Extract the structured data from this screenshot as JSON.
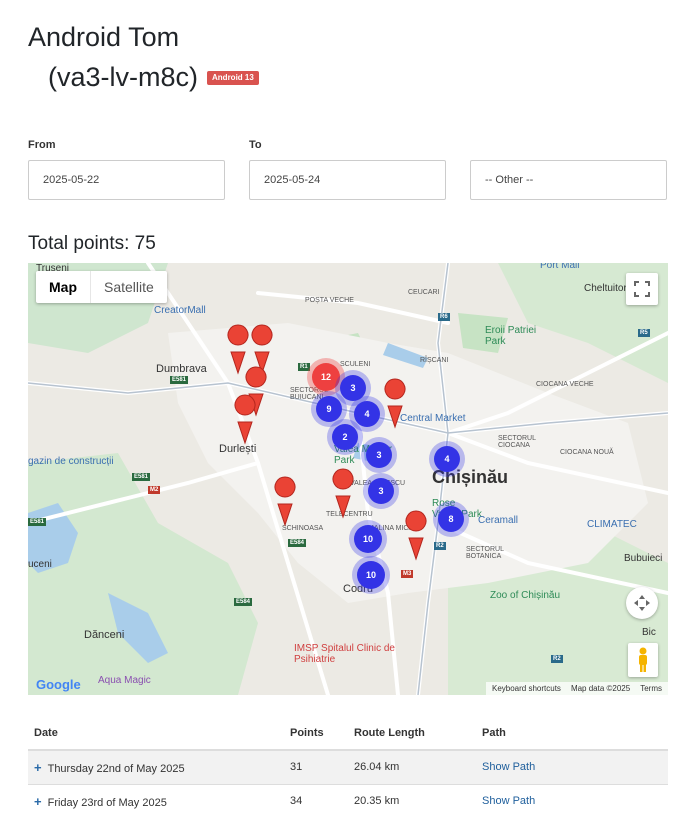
{
  "header": {
    "title": "Android Tom",
    "device": "(va3-lv-m8c)",
    "badge": "Android 13"
  },
  "filters": {
    "from_label": "From",
    "from_value": "2025-05-22",
    "to_label": "To",
    "to_value": "2025-05-24",
    "other_value": "-- Other --"
  },
  "total": "Total points: 75",
  "map": {
    "map_label": "Map",
    "satellite_label": "Satellite",
    "labels": [
      "Truseni",
      "CreatorMall",
      "POȘTA VECHE",
      "CEUCARI",
      "Port Mall",
      "Cheltuitor",
      "Eroii Patriei Park",
      "Dumbrava",
      "SCULENI",
      "RÎȘCANI",
      "CIOCANA VECHE",
      "SECTORUL BUIUCANI",
      "Central Market",
      "Durlești",
      "Valea Morilor Park",
      "SECTORUL CIOCANA",
      "CIOCANA NOUĂ",
      "gazin de construcții",
      "VALEA DICESCU",
      "Chișinău",
      "TELECENTRU",
      "Rose Valley Park",
      "Ceramall",
      "CLIMATEC",
      "SCHINOASA",
      "MALINA MICĂ",
      "SECTORUL BOTANICA",
      "Bubuieci",
      "uceni",
      "Codru",
      "Zoo of Chișinău",
      "Dănceni",
      "Bic",
      "IMSP Spitalul Clinic de Psihiatrie",
      "Aqua Magic"
    ],
    "roads": [
      "R1",
      "E581",
      "M2",
      "E581",
      "E584",
      "E584",
      "R6",
      "R5",
      "R2",
      "M3",
      "R2",
      "E581"
    ],
    "clusters": [
      "12",
      "3",
      "9",
      "4",
      "2",
      "3",
      "4",
      "3",
      "8",
      "10",
      "10"
    ],
    "attrib": {
      "shortcuts": "Keyboard shortcuts",
      "data": "Map data ©2025",
      "terms": "Terms"
    },
    "google": "Google"
  },
  "table": {
    "headers": [
      "Date",
      "Points",
      "Route Length",
      "Path"
    ],
    "rows": [
      {
        "date": "Thursday 22nd of May 2025",
        "points": "31",
        "length": "26.04 km",
        "path": "Show Path"
      },
      {
        "date": "Friday 23rd of May 2025",
        "points": "34",
        "length": "20.35 km",
        "path": "Show Path"
      }
    ]
  }
}
